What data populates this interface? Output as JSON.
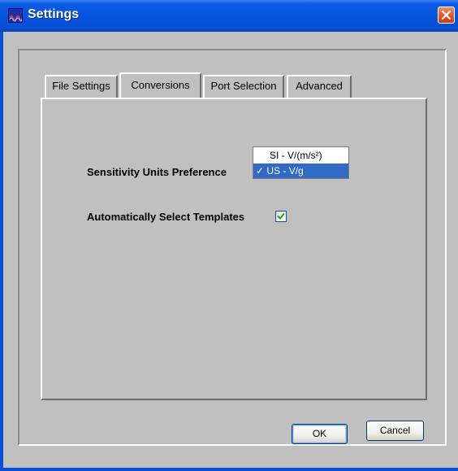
{
  "window": {
    "title": "Settings"
  },
  "icons": {
    "app": "app-icon",
    "close": "close-icon",
    "check": "checkmark-icon"
  },
  "colors": {
    "titlebar": "#0550d6",
    "selection": "#316ac5",
    "close_button": "#e0592d"
  },
  "tabs": [
    {
      "label": "File Settings",
      "selected": false
    },
    {
      "label": "Conversions",
      "selected": true
    },
    {
      "label": "Port Selection",
      "selected": false
    },
    {
      "label": "Advanced",
      "selected": false
    }
  ],
  "conversions": {
    "sensitivity_label": "Sensitivity Units Preference",
    "sensitivity_options": [
      {
        "label": "SI - V/(m/s²)",
        "selected": false
      },
      {
        "label": "✓ US - V/g",
        "selected": true
      }
    ],
    "auto_templates_label": "Automatically Select Templates",
    "auto_templates_checked": true
  },
  "buttons": {
    "ok": "OK",
    "cancel": "Cancel"
  }
}
